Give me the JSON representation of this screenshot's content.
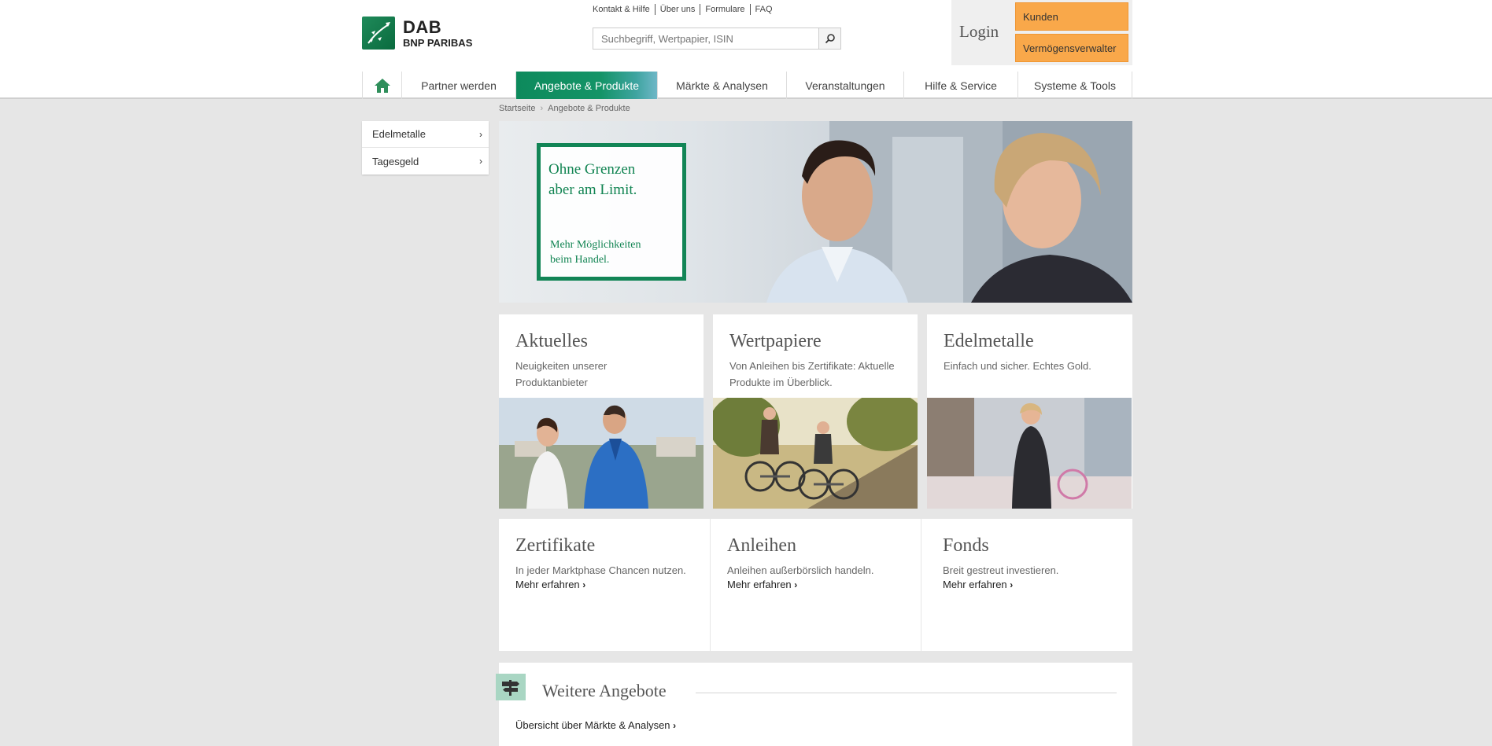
{
  "header": {
    "brand_name": "DAB",
    "brand_sub": "BNP PARIBAS",
    "toplinks": [
      "Kontakt & Hilfe",
      "Über uns",
      "Formulare",
      "FAQ"
    ],
    "search_placeholder": "Suchbegriff, Wertpapier, ISIN",
    "login_label": "Login",
    "login_kunden": "Kunden",
    "login_verm": "Vermögensverwalter"
  },
  "nav": {
    "items": [
      "Partner werden",
      "Angebote & Produkte",
      "Märkte & Analysen",
      "Veranstaltungen",
      "Hilfe & Service",
      "Systeme & Tools"
    ],
    "active_index": 1
  },
  "breadcrumb": [
    "Startseite",
    "Angebote & Produkte"
  ],
  "sidebar": {
    "items": [
      "Edelmetalle",
      "Tagesgeld"
    ]
  },
  "hero": {
    "heading_line1": "Ohne Grenzen",
    "heading_line2": "aber am Limit.",
    "sub_line1": "Mehr Möglichkeiten",
    "sub_line2": "beim Handel."
  },
  "tiles_top": [
    {
      "title": "Aktuelles",
      "desc": "Neuigkeiten unserer Produktanbieter"
    },
    {
      "title": "Wertpapiere",
      "desc": "Von Anleihen bis Zertifikate: Aktuelle Produkte im Überblick."
    },
    {
      "title": "Edelmetalle",
      "desc": "Einfach und sicher. Echtes Gold."
    }
  ],
  "tiles_bottom": [
    {
      "title": "Zertifikate",
      "desc": "In jeder Marktphase Chancen nutzen.",
      "more": "Mehr erfahren"
    },
    {
      "title": "Anleihen",
      "desc": "Anleihen außerbörslich handeln.",
      "more": "Mehr erfahren"
    },
    {
      "title": "Fonds",
      "desc": "Breit gestreut investieren.",
      "more": "Mehr erfahren"
    }
  ],
  "weitere": {
    "title": "Weitere Angebote",
    "link": "Übersicht über Märkte & Analysen"
  },
  "colors": {
    "brand_green": "#128556",
    "login_orange": "#f9a84a",
    "background": "#e6e6e6"
  }
}
